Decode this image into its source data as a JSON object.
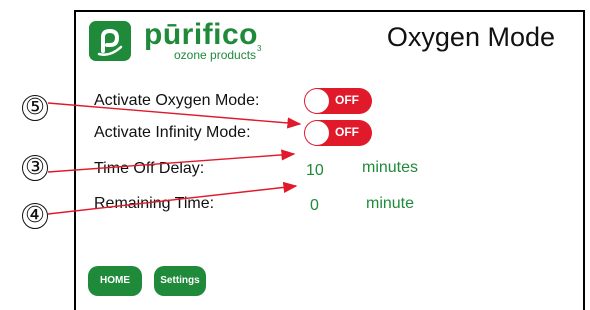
{
  "header": {
    "brand_name": "pūrifico",
    "brand_tagline": "ozone products",
    "brand_superscript": "3",
    "page_title": "Oxygen Mode"
  },
  "settings": {
    "oxygen_mode": {
      "label": "Activate Oxygen Mode:",
      "state": "OFF"
    },
    "infinity_mode": {
      "label": "Activate Infinity Mode:",
      "state": "OFF"
    },
    "time_off_delay": {
      "label": "Time Off Delay:",
      "value": "10",
      "unit": "minutes"
    },
    "remaining_time": {
      "label": "Remaining Time:",
      "value": "0",
      "unit": "minute"
    }
  },
  "buttons": {
    "home": "HOME",
    "settings": "Settings"
  },
  "callouts": {
    "oxygen_toggle": "⑤",
    "time_delay": "③",
    "remaining": "④"
  },
  "colors": {
    "brand_green": "#1f8a3a",
    "toggle_off_red": "#e0192b",
    "annotation_red": "#e0192b"
  }
}
